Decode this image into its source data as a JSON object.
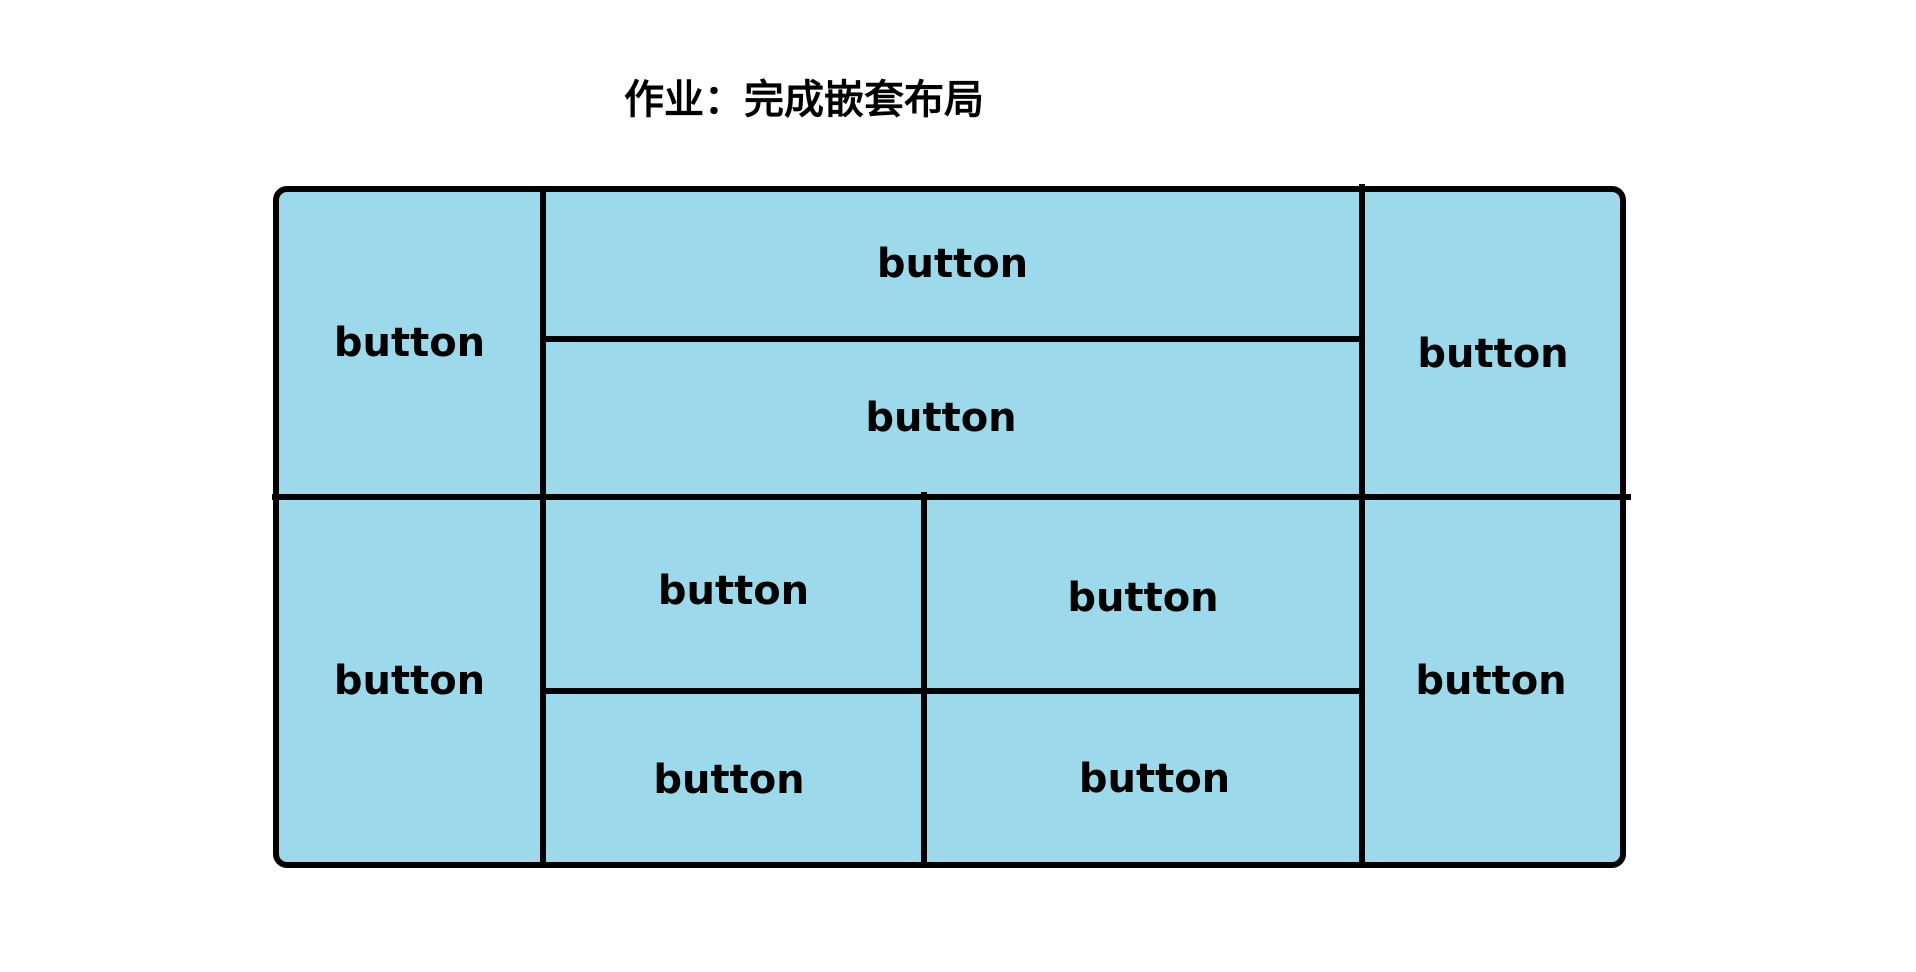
{
  "title": "作业：完成嵌套布局",
  "layout": {
    "fill_color": "#9cd9ea",
    "line_color": "#000000"
  },
  "buttons": {
    "left_top": "button",
    "left_bottom": "button",
    "center_top": "button",
    "center_middle": "button",
    "grid_top_left": "button",
    "grid_top_right": "button",
    "grid_bottom_left": "button",
    "grid_bottom_right": "button",
    "right_top": "button",
    "right_bottom": "button"
  }
}
